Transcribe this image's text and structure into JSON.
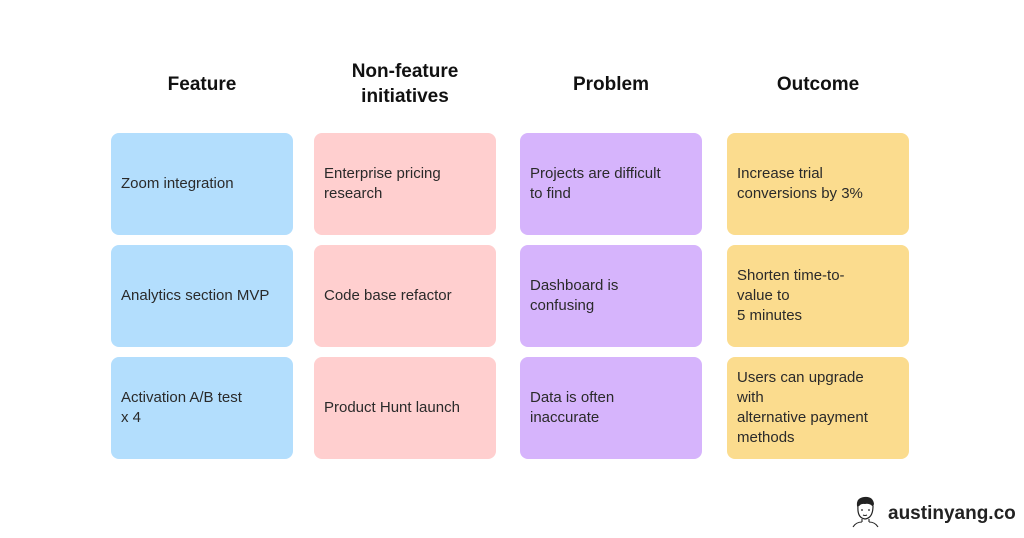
{
  "columns": [
    {
      "header": "Feature",
      "color": "#B3DEFD",
      "items": [
        "Zoom integration",
        "Analytics section MVP",
        "Activation A/B test\nx 4"
      ]
    },
    {
      "header": "Non-feature\ninitiatives",
      "color": "#FFCFCF",
      "items": [
        "Enterprise pricing\nresearch",
        "Code base refactor",
        "Product Hunt launch"
      ]
    },
    {
      "header": "Problem",
      "color": "#D6B4FC",
      "items": [
        "Projects are difficult\nto find",
        "Dashboard is\nconfusing",
        "Data is often\ninaccurate"
      ]
    },
    {
      "header": "Outcome",
      "color": "#FBDC8E",
      "items": [
        "Increase trial\nconversions by 3%",
        "Shorten time-to-\nvalue to\n5 minutes",
        "Users can upgrade\nwith\nalternative payment\nmethods"
      ]
    }
  ],
  "brand": {
    "name": "austinyang.co",
    "logo_icon": "avatar-face-icon"
  }
}
